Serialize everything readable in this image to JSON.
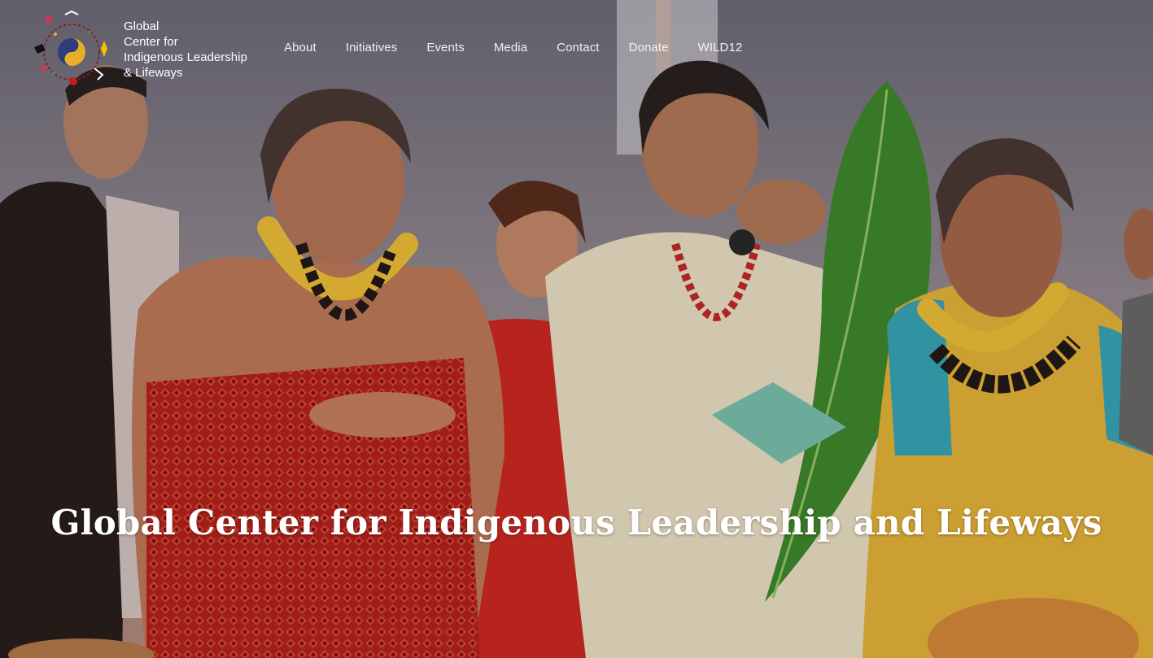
{
  "logo": {
    "lines": [
      "Global",
      "Center for",
      "Indigenous Leadership",
      "& Lifeways"
    ],
    "icon": "medicine-wheel-logo-icon"
  },
  "nav": {
    "items": [
      "About",
      "Initiatives",
      "Events",
      "Media",
      "Contact",
      "Donate",
      "WILD12"
    ]
  },
  "hero": {
    "headline": "Global Center for Indigenous Leadership and Lifeways",
    "image": "ceremony-photo"
  },
  "colors": {
    "nav_text": "#f4f1ef",
    "headline": "#ffffff"
  }
}
